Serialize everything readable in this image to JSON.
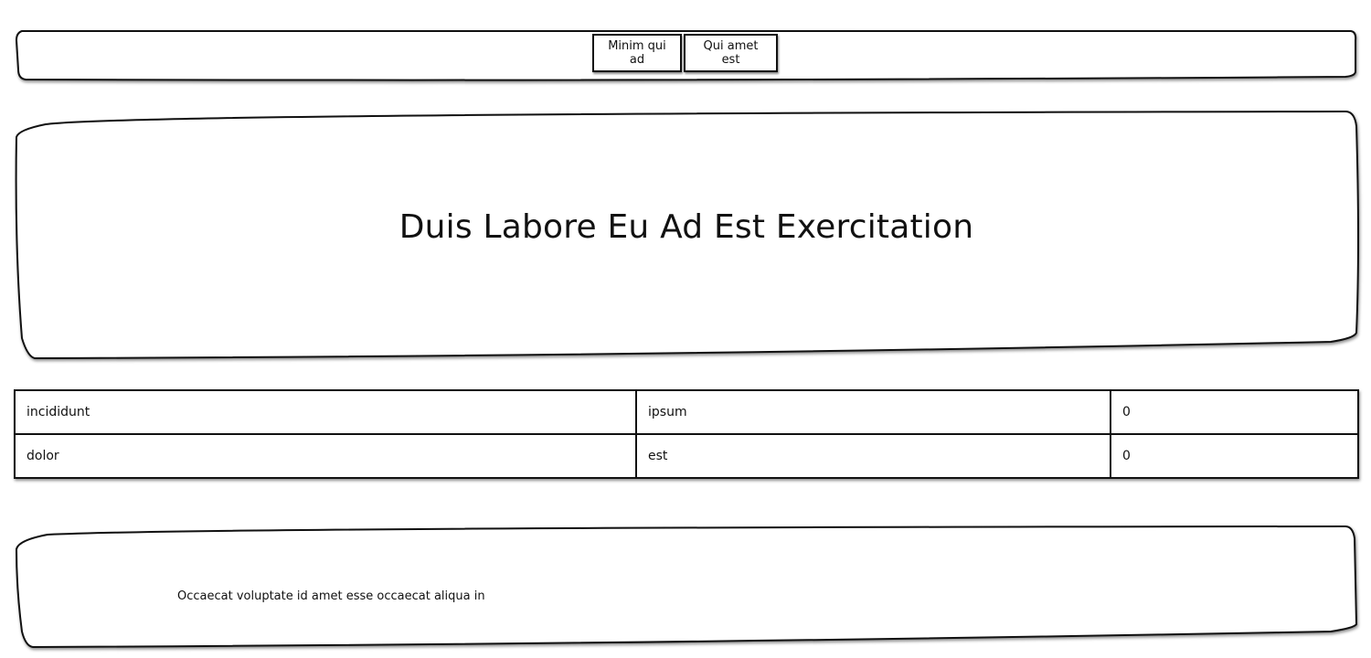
{
  "nav": {
    "buttons": [
      {
        "label": "Minim qui ad"
      },
      {
        "label": "Qui amet est"
      }
    ]
  },
  "hero": {
    "title": "Duis Labore Eu Ad Est Exercitation"
  },
  "table": {
    "rows": [
      [
        "incididunt",
        "ipsum",
        "0"
      ],
      [
        "dolor",
        "est",
        "0"
      ]
    ]
  },
  "footer": {
    "text": "Occaecat voluptate id amet esse occaecat aliqua in"
  }
}
